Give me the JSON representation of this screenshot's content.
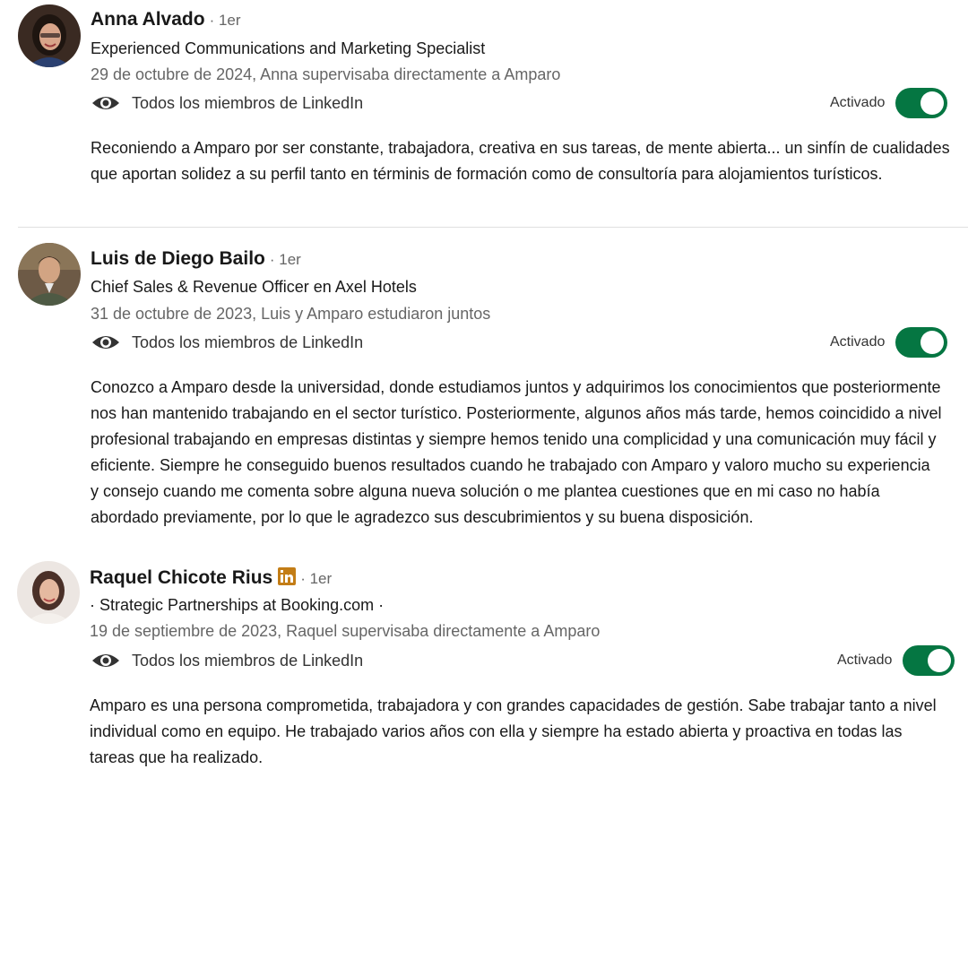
{
  "recommendations": [
    {
      "name": "Anna Alvado",
      "degree": "· 1er",
      "headline": "Experienced Communications and Marketing Specialist",
      "relation": "29 de octubre de 2024, Anna supervisaba directamente a Amparo",
      "visibility": "Todos los miembros de LinkedIn",
      "toggle_label": "Activado",
      "toggle_on": true,
      "text": "Reconiendo a Amparo por ser constante, trabajadora, creativa en sus tareas, de mente abierta... un sinfín de cualidades que aportan solidez a su perfil tanto en términis de formación como de consultoría para alojamientos turísticos.",
      "avatar_icon": "profile-photo"
    },
    {
      "name": "Luis de Diego Bailo",
      "degree": "· 1er",
      "headline": "Chief Sales & Revenue Officer en Axel Hotels",
      "relation": "31 de octubre de 2023, Luis y Amparo estudiaron juntos",
      "visibility": "Todos los miembros de LinkedIn",
      "toggle_label": "Activado",
      "toggle_on": true,
      "text": "Conozco a Amparo desde la universidad, donde estudiamos juntos y adquirimos los conocimientos que posteriormente nos han mantenido trabajando en el sector turístico. Posteriormente, algunos años más tarde, hemos coincidido a nivel profesional trabajando en empresas distintas y siempre hemos tenido una complicidad y una comunicación muy fácil y eficiente. Siempre he conseguido buenos resultados cuando he trabajado con Amparo y valoro mucho su experiencia y consejo cuando me comenta sobre alguna nueva solución o me plantea cuestiones que en mi caso no había abordado previamente, por lo que le agradezco sus descubrimientos y su buena disposición.",
      "avatar_icon": "profile-photo"
    },
    {
      "name": "Raquel Chicote Rius",
      "degree": "· 1er",
      "badge_icon": "linkedin-premium-icon",
      "badge_text": "in",
      "headline": "· Strategic Partnerships at Booking.com ·",
      "relation": "19 de septiembre de 2023, Raquel supervisaba directamente a Amparo",
      "visibility": "Todos los miembros de LinkedIn",
      "toggle_label": "Activado",
      "toggle_on": true,
      "text": "Amparo es una persona comprometida, trabajadora y con grandes capacidades de gestión. Sabe trabajar tanto a nivel individual como en equipo. He trabajado varios años con ella y siempre ha estado abierta y proactiva en todas las tareas que ha realizado.",
      "avatar_icon": "profile-photo"
    }
  ],
  "colors": {
    "toggle_on": "#057642",
    "premium_badge": "#c37d16",
    "secondary_text": "#666666",
    "primary_text": "#191919"
  }
}
